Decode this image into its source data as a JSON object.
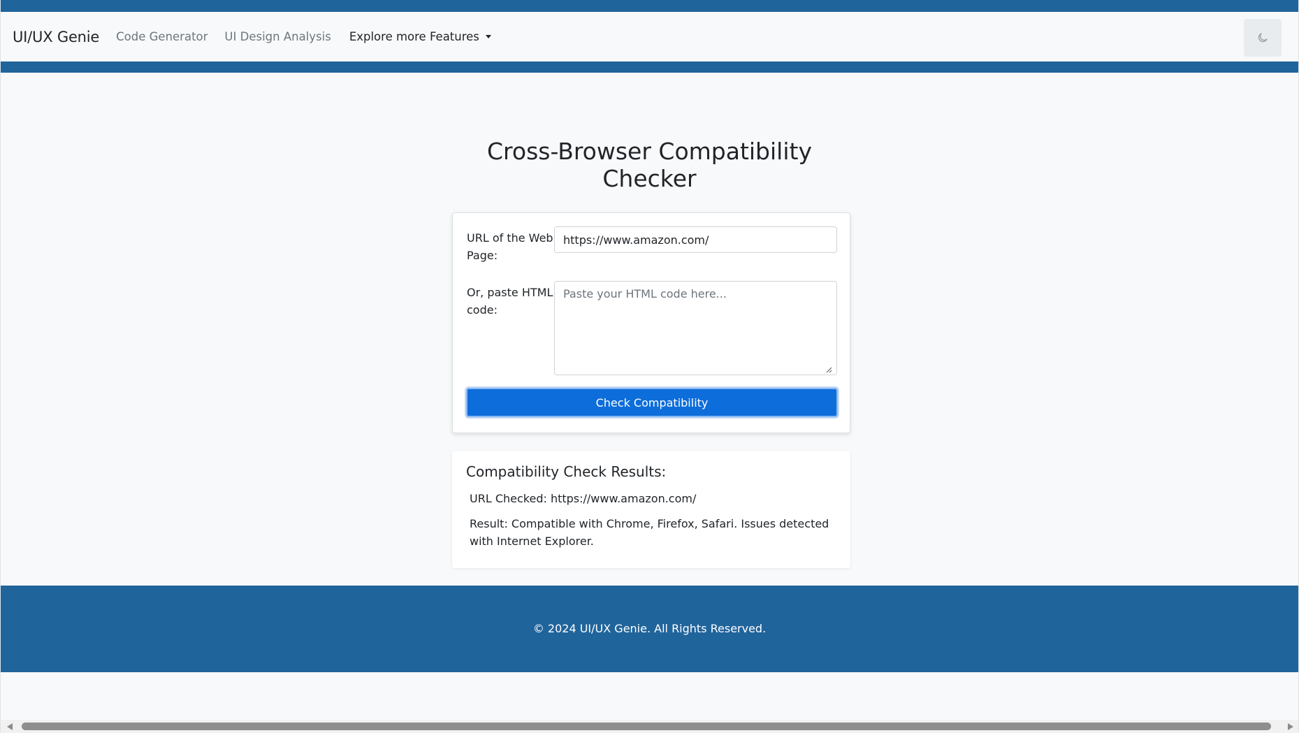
{
  "navbar": {
    "brand": "UI/UX Genie",
    "links": [
      "Code Generator",
      "UI Design Analysis"
    ],
    "dropdown_label": "Explore more Features",
    "theme_toggle_icon": "moon-icon"
  },
  "main": {
    "title": "Cross-Browser Compatibility Checker",
    "form": {
      "url_label": "URL of the Web Page:",
      "url_value": "https://www.amazon.com/",
      "html_label": "Or, paste HTML code:",
      "html_placeholder": "Paste your HTML code here...",
      "submit_label": "Check Compatibility"
    },
    "results": {
      "heading": "Compatibility Check Results:",
      "url_checked": "URL Checked: https://www.amazon.com/",
      "result_text": "Result: Compatible with Chrome, Firefox, Safari. Issues detected with Internet Explorer."
    }
  },
  "footer": {
    "text": "© 2024 UI/UX Genie. All Rights Reserved."
  },
  "colors": {
    "brand_blue": "#20649c",
    "button_blue": "#0d6ddb",
    "background": "#f8f9fa"
  }
}
